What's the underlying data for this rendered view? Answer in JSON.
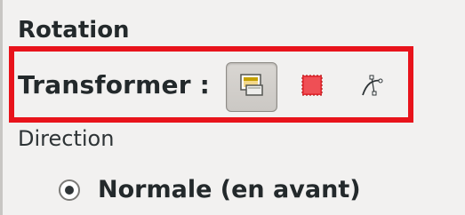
{
  "section": {
    "title": "Rotation"
  },
  "transform": {
    "label": "Transformer :",
    "tools": [
      {
        "icon": "layer-icon",
        "active": true
      },
      {
        "icon": "selection-icon",
        "active": false
      },
      {
        "icon": "path-icon",
        "active": false
      }
    ]
  },
  "direction": {
    "label": "Direction",
    "selected_option": "Normale (en avant)"
  },
  "colors": {
    "highlight": "#e8131b",
    "selection_fill": "#e8333a"
  }
}
